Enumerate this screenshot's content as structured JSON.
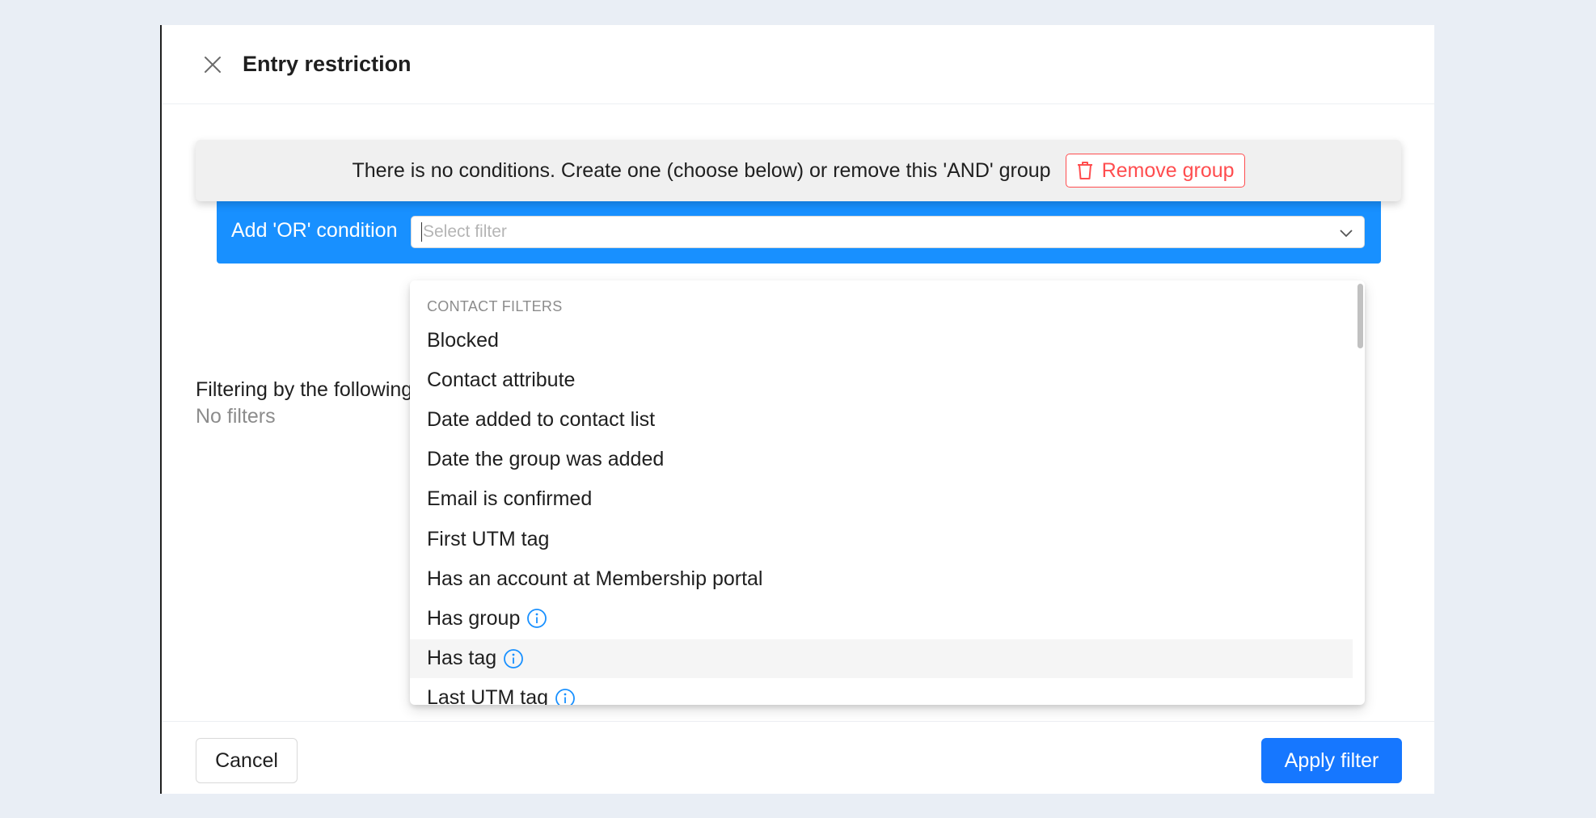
{
  "modal": {
    "title": "Entry restriction",
    "close_icon": "close-icon"
  },
  "group": {
    "message": "There is no conditions. Create one (choose below) or remove this 'AND' group",
    "remove_label": "Remove group",
    "remove_icon": "trash-icon",
    "accent_color": "#ff4d4f"
  },
  "or_condition": {
    "label": "Add 'OR' condition",
    "bar_color": "#1890ff",
    "select": {
      "placeholder": "Select filter",
      "icon": "chevron-down-icon"
    }
  },
  "filters_panel": {
    "label": "Filtering by the following",
    "empty_text": "No filters"
  },
  "dropdown": {
    "group_title": "CONTACT FILTERS",
    "items": [
      {
        "label": "Blocked",
        "info": false
      },
      {
        "label": "Contact attribute",
        "info": false
      },
      {
        "label": "Date added to contact list",
        "info": false
      },
      {
        "label": "Date the group was added",
        "info": false
      },
      {
        "label": "Email is confirmed",
        "info": false
      },
      {
        "label": "First UTM tag",
        "info": false
      },
      {
        "label": "Has an account at Membership portal",
        "info": false
      },
      {
        "label": "Has group",
        "info": true
      },
      {
        "label": "Has tag",
        "info": true,
        "hovered": true
      },
      {
        "label": "Last UTM tag",
        "info": true
      }
    ],
    "info_icon": "info-circle-icon",
    "info_color": "#1890ff"
  },
  "footer": {
    "cancel_label": "Cancel",
    "apply_label": "Apply filter",
    "apply_color": "#1677ff"
  }
}
